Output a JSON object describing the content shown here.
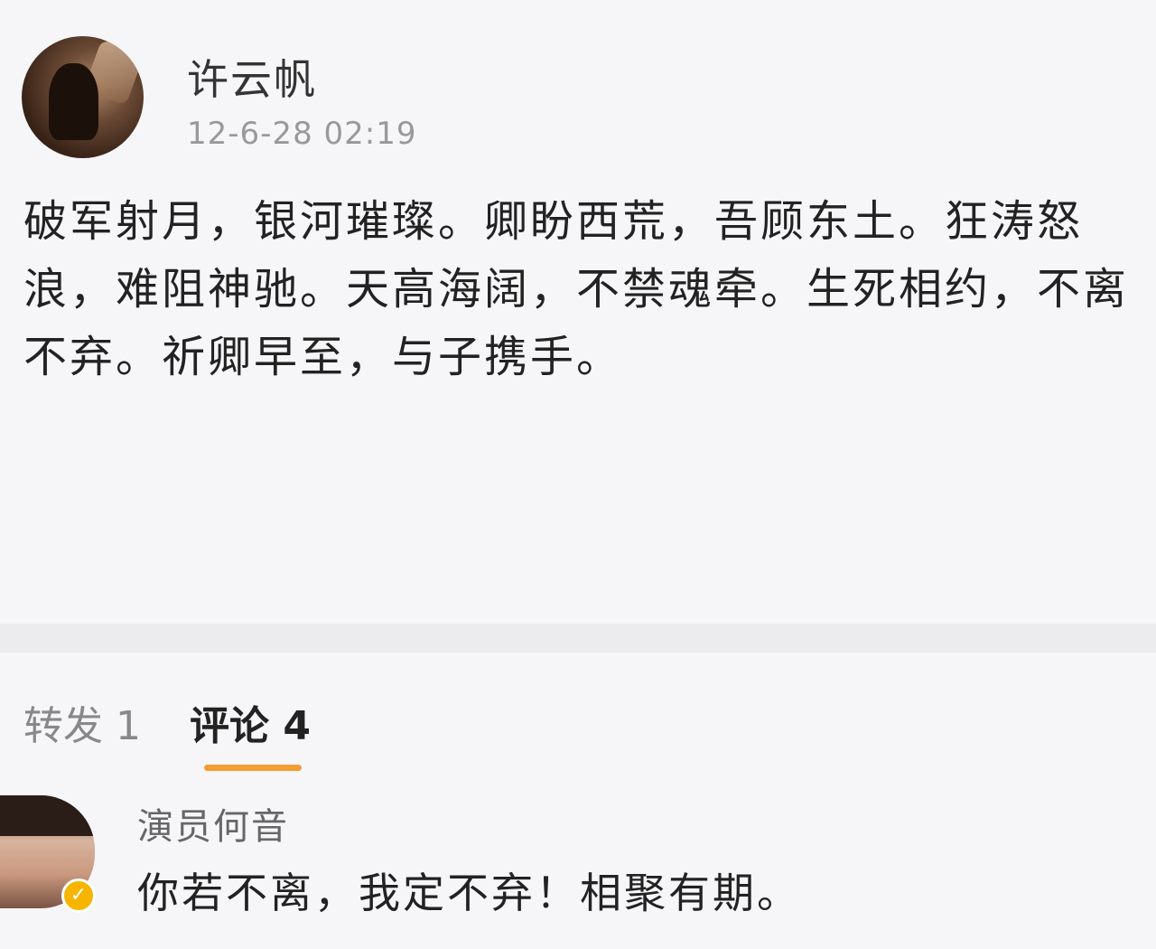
{
  "post": {
    "author": "许云帆",
    "time": "12-6-28 02:19",
    "text": "破军射月，银河璀璨。卿盼西荒，吾顾东土。狂涛怒浪，难阻神驰。天高海阔，不禁魂牵。生死相约，不离不弃。祈卿早至，与子携手。"
  },
  "tabs": {
    "repost": "转发 1",
    "comments": "评论 4",
    "active_color": "#f39c35"
  },
  "comment": {
    "author": "演员何音",
    "text": "你若不离，我定不弃！相聚有期。",
    "badge": "✓"
  }
}
